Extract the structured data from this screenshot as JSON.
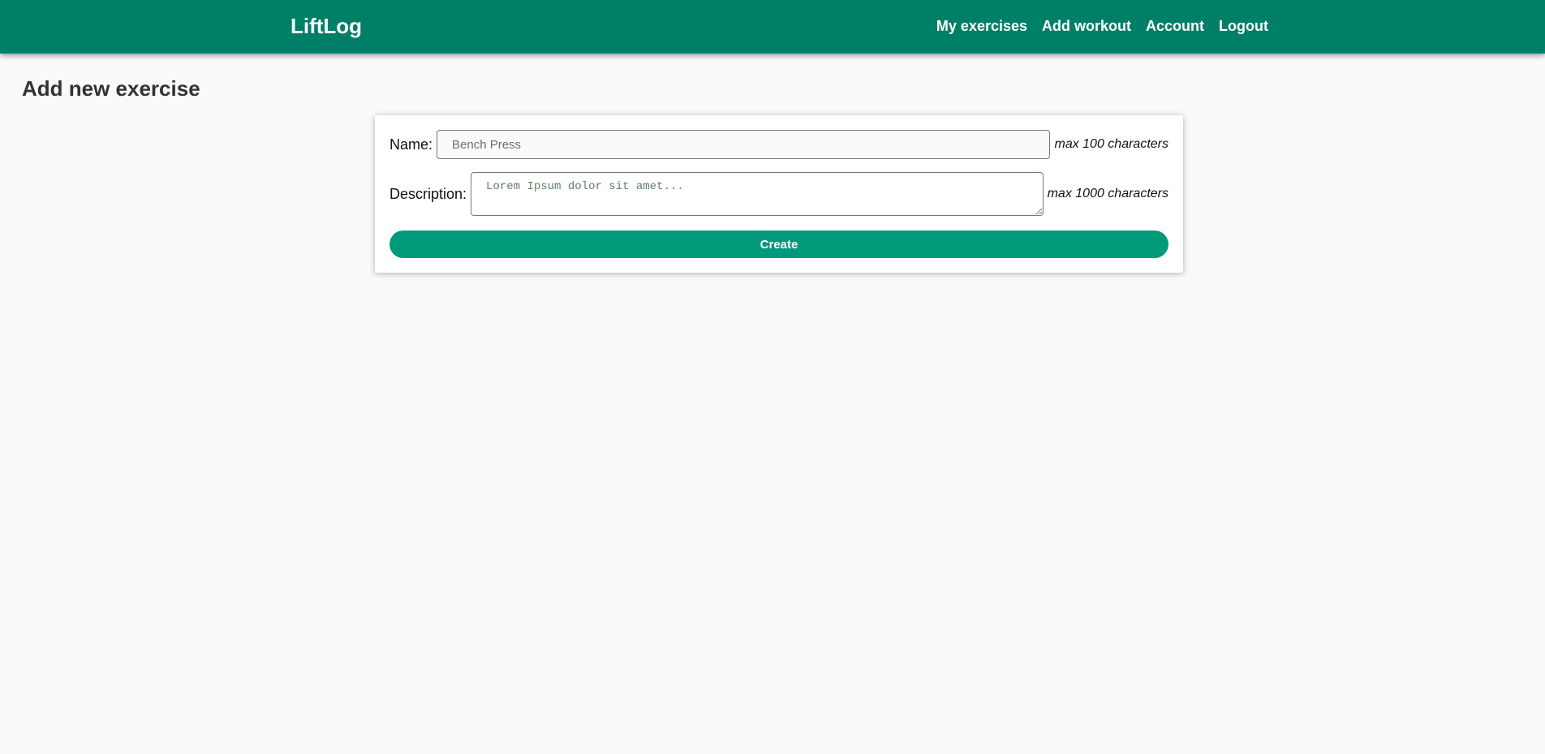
{
  "header": {
    "brand": "LiftLog",
    "nav": [
      {
        "label": "My exercises"
      },
      {
        "label": "Add workout"
      },
      {
        "label": "Account"
      },
      {
        "label": "Logout"
      }
    ],
    "background_color": "#007f68"
  },
  "page": {
    "title": "Add new exercise"
  },
  "form": {
    "name": {
      "label": "Name:",
      "value": "",
      "placeholder": "Bench Press",
      "hint": "max 100 characters"
    },
    "description": {
      "label": "Description:",
      "value": "",
      "placeholder": "Lorem Ipsum dolor sit amet...",
      "hint": "max 1000 characters"
    },
    "submit_label": "Create",
    "submit_color": "#009a7a"
  }
}
